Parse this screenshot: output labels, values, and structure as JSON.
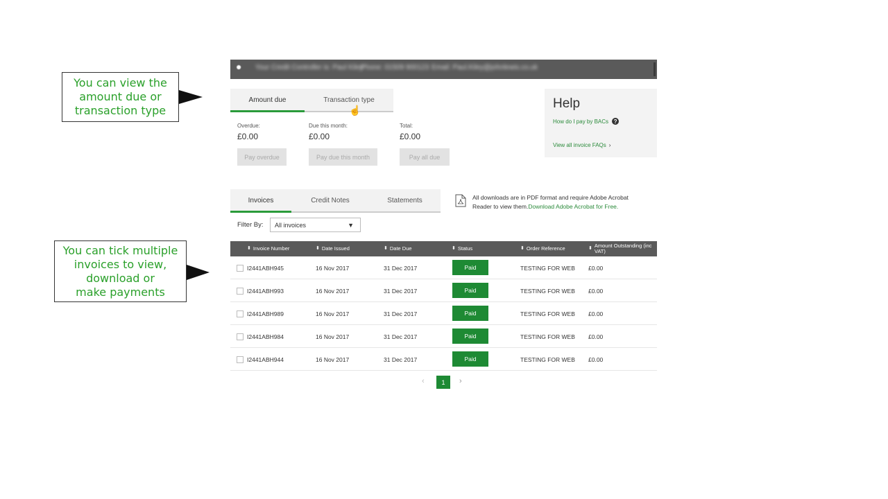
{
  "callouts": {
    "view_amount": [
      "You can view the",
      "amount due or",
      "transaction type"
    ],
    "tick_invoices": [
      "You can tick multiple",
      "invoices to view,",
      "download or",
      "make payments"
    ]
  },
  "topbar": {
    "logo_icon": "logo-icon",
    "blurred": [
      "Your Credit Controller is: Paul Kiley",
      "Phone: 01509 900123",
      "Email: Paul.Kiley@johnlewis.co.uk"
    ]
  },
  "amount_tabs": [
    {
      "label": "Amount due",
      "active": true
    },
    {
      "label": "Transaction type",
      "active": false
    }
  ],
  "summary": {
    "overdue": {
      "label": "Overdue:",
      "value": "£0.00",
      "button": "Pay overdue"
    },
    "due_month": {
      "label": "Due this month:",
      "value": "£0.00",
      "button": "Pay due this month"
    },
    "total": {
      "label": "Total:",
      "value": "£0.00",
      "button": "Pay all due"
    }
  },
  "help": {
    "title": "Help",
    "bacs_link": "How do I pay by BACs",
    "help_icon": "?",
    "faq_link": "View all invoice FAQs",
    "chevron": "›"
  },
  "doc_tabs": [
    {
      "label": "Invoices",
      "active": true
    },
    {
      "label": "Credit Notes",
      "active": false
    },
    {
      "label": "Statements",
      "active": false
    }
  ],
  "pdf_note": {
    "text": "All downloads are in PDF format and require Adobe Acrobat Reader to view them.",
    "link": "Download Adobe Acrobat for Free."
  },
  "filter": {
    "label": "Filter By:",
    "selected": "All invoices",
    "caret": "▼"
  },
  "table": {
    "headers": [
      "Invoice Number",
      "Date Issued",
      "Date Due",
      "Status",
      "Order Reference",
      "Amount Outstanding (inc VAT)"
    ],
    "sort_icon": "⬍",
    "rows": [
      {
        "invoice": "I2441ABH945",
        "issued": "16 Nov 2017",
        "due": "31 Dec 2017",
        "status": "Paid",
        "ref": "TESTING FOR WEB",
        "amount": "£0.00"
      },
      {
        "invoice": "I2441ABH993",
        "issued": "16 Nov 2017",
        "due": "31 Dec 2017",
        "status": "Paid",
        "ref": "TESTING FOR WEB",
        "amount": "£0.00"
      },
      {
        "invoice": "I2441ABH989",
        "issued": "16 Nov 2017",
        "due": "31 Dec 2017",
        "status": "Paid",
        "ref": "TESTING FOR WEB",
        "amount": "£0.00"
      },
      {
        "invoice": "I2441ABH984",
        "issued": "16 Nov 2017",
        "due": "31 Dec 2017",
        "status": "Paid",
        "ref": "TESTING FOR WEB",
        "amount": "£0.00"
      },
      {
        "invoice": "I2441ABH944",
        "issued": "16 Nov 2017",
        "due": "31 Dec 2017",
        "status": "Paid",
        "ref": "TESTING FOR WEB",
        "amount": "£0.00"
      }
    ]
  },
  "pager": {
    "prev": "‹",
    "current": "1",
    "next": "›"
  },
  "colors": {
    "accent": "#2a9b3a",
    "status_paid": "#1e8a34",
    "callout_text": "#2aa02a",
    "header_bg": "#5a5a5a"
  }
}
